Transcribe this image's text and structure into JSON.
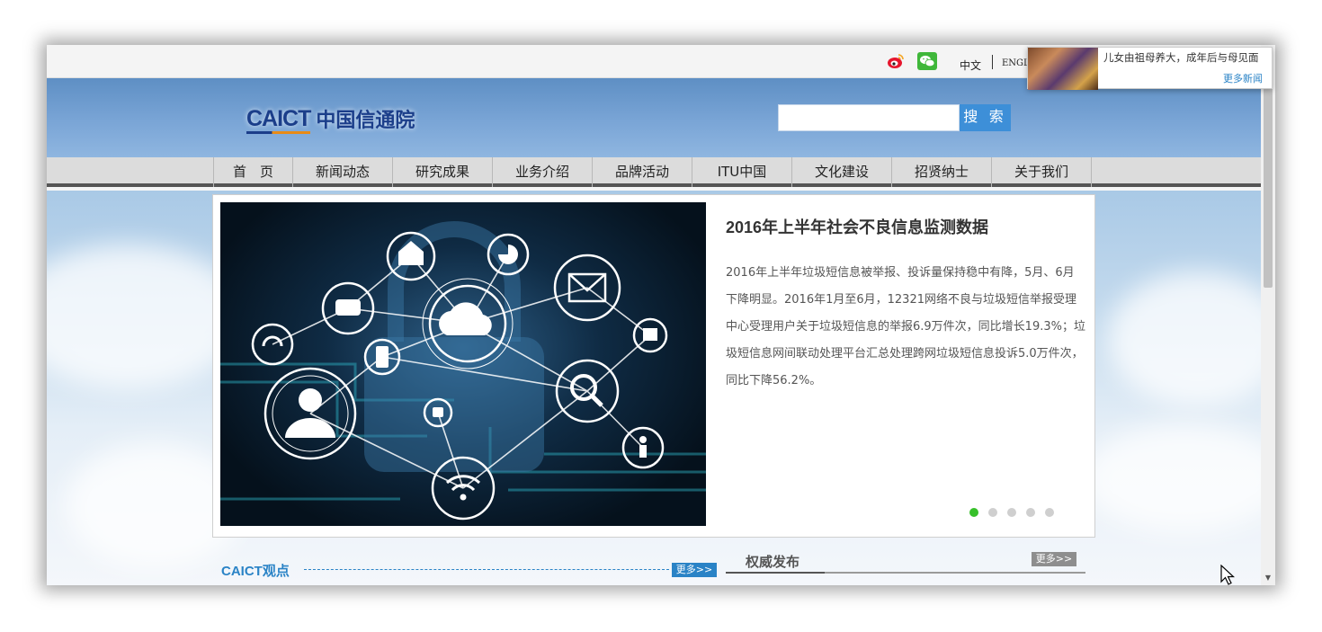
{
  "topbar": {
    "weibo_icon": "weibo-icon",
    "wechat_icon": "wechat-icon",
    "lang_zh": "中文",
    "lang_en": "ENGLISH"
  },
  "header": {
    "logo_en": "CAICT",
    "logo_cn": "中国信通院",
    "search_placeholder": "",
    "search_button": "搜 索"
  },
  "nav": {
    "items": [
      {
        "label": "首　页"
      },
      {
        "label": "新闻动态"
      },
      {
        "label": "研究成果"
      },
      {
        "label": "业务介绍"
      },
      {
        "label": "品牌活动"
      },
      {
        "label": "ITU中国"
      },
      {
        "label": "文化建设"
      },
      {
        "label": "招贤纳士"
      },
      {
        "label": "关于我们"
      }
    ]
  },
  "slider": {
    "title": "2016年上半年社会不良信息监测数据",
    "text": "2016年上半年垃圾短信息被举报、投诉量保持稳中有降，5月、6月下降明显。2016年1月至6月，12321网络不良与垃圾短信举报受理中心受理用户关于垃圾短信息的举报6.9万件次，同比增长19.3%；垃圾短信息网间联动处理平台汇总处理跨网垃圾短信息投诉5.0万件次，同比下降56.2%。",
    "dot_count": 5,
    "active_dot": 0,
    "accent_color": "#37c02a"
  },
  "sections": {
    "left_title": "CAICT观点",
    "left_more": "更多>>",
    "right_title": "权威发布",
    "right_more": "更多>>"
  },
  "popup": {
    "text": "儿女由祖母养大，成年后与母见面",
    "more": "更多新闻"
  },
  "colors": {
    "brand_blue": "#1b3e8a",
    "link_blue": "#2a83c6",
    "search_button": "#3d8fd8"
  }
}
